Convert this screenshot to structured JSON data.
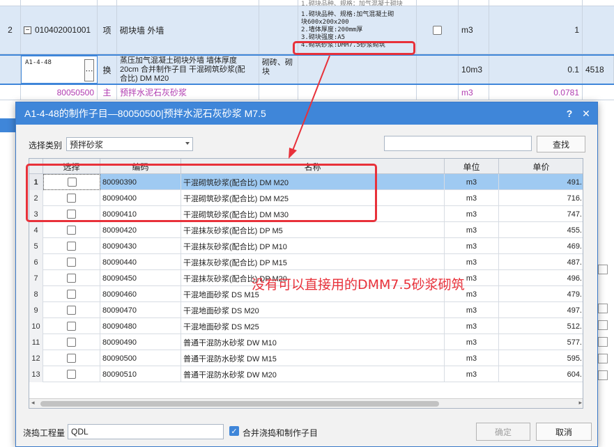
{
  "bg": {
    "row0_text": "1.砌块品种、规格：加气混凝土砌块",
    "row2": {
      "index": "2",
      "code": "010402001001",
      "type": "项",
      "name": "砌块墙 外墙",
      "features": [
        "1.砌块品种、规格:加气混凝土砌",
        "块600x200x200",
        "2.墙体厚度:200mm厚",
        "3.砌块强度:A5",
        "4.砌筑砂浆:DMM7.5砂浆砌筑"
      ],
      "unit": "m3",
      "qty": "1"
    },
    "row3": {
      "code": "A1-4-48",
      "type": "换",
      "name_lines": [
        "蒸压加气混凝土砌块外墙 墙体厚度",
        "20cm  合并制作子目 干混砌筑砂浆(配",
        "合比) DM M20"
      ],
      "category_lines": [
        "砌砖、砌",
        "块"
      ],
      "unit": "10m3",
      "qty": "0.1",
      "extra": "4518"
    },
    "row4": {
      "code": "80050500",
      "type": "主",
      "name": "预拌水泥石灰砂浆",
      "unit": "m3",
      "qty": "0.0781"
    }
  },
  "dialog": {
    "title": "A1-4-48的制作子目—80050500|预拌水泥石灰砂浆 M7.5",
    "help": "?",
    "close": "✕",
    "category_label": "选择类别",
    "category_value": "预拌砂浆",
    "search_value": "",
    "search_button": "查找",
    "columns": [
      "",
      "选择",
      "编码",
      "名称",
      "单位",
      "单价"
    ],
    "rows": [
      {
        "n": "1",
        "code": "80090390",
        "name": "干混砌筑砂浆(配合比) DM M20",
        "unit": "m3",
        "price": "491."
      },
      {
        "n": "2",
        "code": "80090400",
        "name": "干混砌筑砂浆(配合比) DM M25",
        "unit": "m3",
        "price": "716."
      },
      {
        "n": "3",
        "code": "80090410",
        "name": "干混砌筑砂浆(配合比) DM M30",
        "unit": "m3",
        "price": "747."
      },
      {
        "n": "4",
        "code": "80090420",
        "name": "干混抹灰砂浆(配合比) DP M5",
        "unit": "m3",
        "price": "455."
      },
      {
        "n": "5",
        "code": "80090430",
        "name": "干混抹灰砂浆(配合比) DP M10",
        "unit": "m3",
        "price": "469."
      },
      {
        "n": "6",
        "code": "80090440",
        "name": "干混抹灰砂浆(配合比) DP M15",
        "unit": "m3",
        "price": "487."
      },
      {
        "n": "7",
        "code": "80090450",
        "name": "干混抹灰砂浆(配合比) DP M20",
        "unit": "m3",
        "price": "496."
      },
      {
        "n": "8",
        "code": "80090460",
        "name": "干混地面砂浆 DS M15",
        "unit": "m3",
        "price": "479."
      },
      {
        "n": "9",
        "code": "80090470",
        "name": "干混地面砂浆 DS M20",
        "unit": "m3",
        "price": "497."
      },
      {
        "n": "10",
        "code": "80090480",
        "name": "干混地面砂浆 DS M25",
        "unit": "m3",
        "price": "512."
      },
      {
        "n": "11",
        "code": "80090490",
        "name": "普通干混防水砂浆 DW M10",
        "unit": "m3",
        "price": "577."
      },
      {
        "n": "12",
        "code": "80090500",
        "name": "普通干混防水砂浆 DW M15",
        "unit": "m3",
        "price": "595."
      },
      {
        "n": "13",
        "code": "80090510",
        "name": "普通干混防水砂浆 DW M20",
        "unit": "m3",
        "price": "604."
      }
    ],
    "qty_label": "浇捣工程量",
    "qty_value": "QDL",
    "merge_label": "合并浇捣和制作子目",
    "ok": "确定",
    "cancel": "取消"
  },
  "annotation": "没有可以直接用的DMM7.5砂浆砌筑",
  "colors": {
    "annotation": "#e8313a",
    "titlebar": "#3f86d9",
    "selected_row": "#9fcaf2"
  }
}
